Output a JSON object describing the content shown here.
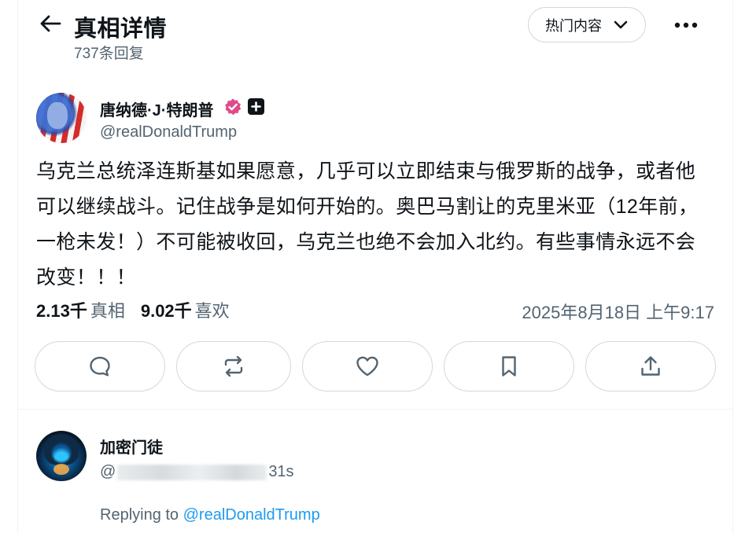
{
  "header": {
    "title": "真相详情",
    "reply_count": "737条回复",
    "sort_label": "热门内容"
  },
  "post": {
    "author_name": "唐纳德·J·特朗普",
    "handle": "@realDonaldTrump",
    "text": "乌克兰总统泽连斯基如果愿意，几乎可以立即结束与俄罗斯的战争，或者他可以继续战斗。记住战争是如何开始的。奥巴马割让的克里米亚（12年前，一枪未发！）不可能被收回，乌克兰也绝不会加入北约。有些事情永远不会改变！！！",
    "retruths_count": "2.13千",
    "retruths_label": "真相",
    "likes_count": "9.02千",
    "likes_label": "喜欢",
    "timestamp": "2025年8月18日 上午9:17"
  },
  "actions": [
    "reply-icon",
    "retruth-icon",
    "heart-icon",
    "bookmark-icon",
    "share-icon"
  ],
  "reply": {
    "author_name": "加密门徒",
    "handle_prefix": "@",
    "handle_suffix": "31s",
    "replying_to_label": "Replying to",
    "replying_to_handle": "@realDonaldTrump"
  },
  "colors": {
    "text": "#0f1419",
    "muted": "#536471",
    "border": "#cfd9de",
    "link": "#1d9bf0",
    "verified_badge": "#e14a8a"
  }
}
